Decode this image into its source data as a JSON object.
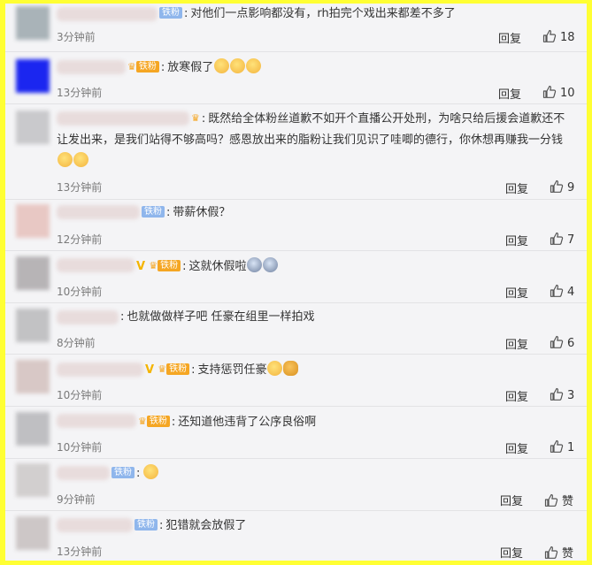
{
  "reply_label": "回复",
  "comments": [
    {
      "badge": "铁粉",
      "text": "对他们一点影响都没有，rh拍完个戏出来都差不多了",
      "time": "3分钟前",
      "likes": "18"
    },
    {
      "badge": "铁粉",
      "text": "放寒假了",
      "time": "13分钟前",
      "likes": "10"
    },
    {
      "badge": "",
      "text": "既然给全体粉丝道歉不如开个直播公开处刑，为啥只给后援会道歉还不让发出来，是我们站得不够高吗？感恩放出来的脂粉让我们见识了哇唧的德行，你休想再赚我一分钱",
      "time": "13分钟前",
      "likes": "9"
    },
    {
      "badge": "铁粉",
      "text": "带薪休假？",
      "time": "12分钟前",
      "likes": "7"
    },
    {
      "badge": "铁粉",
      "text": "这就休假啦",
      "time": "10分钟前",
      "likes": "4"
    },
    {
      "badge": "",
      "text": "也就做做样子吧 任豪在组里一样拍戏",
      "time": "8分钟前",
      "likes": "6"
    },
    {
      "badge": "铁粉",
      "text": "支持惩罚任豪",
      "time": "10分钟前",
      "likes": "3"
    },
    {
      "badge": "铁粉",
      "text": "还知道他违背了公序良俗啊",
      "time": "10分钟前",
      "likes": "1"
    },
    {
      "badge": "铁粉",
      "text": "",
      "time": "9分钟前",
      "likes": "赞"
    },
    {
      "badge": "铁粉",
      "text": "犯错就会放假了",
      "time": "13分钟前",
      "likes": "赞"
    }
  ]
}
